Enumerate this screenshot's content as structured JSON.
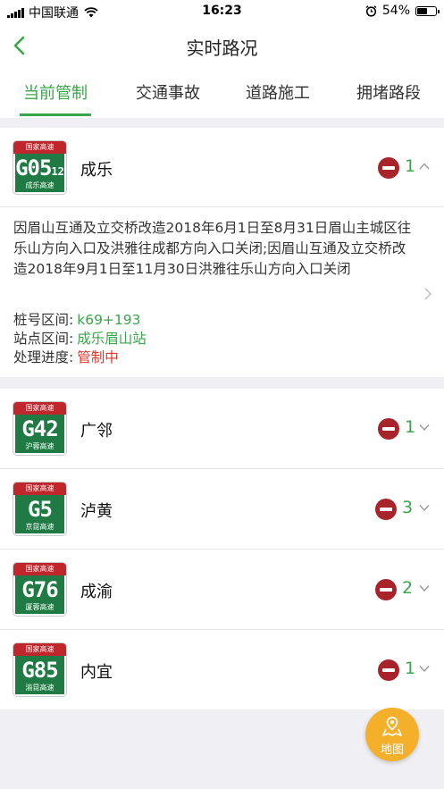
{
  "status": {
    "carrier": "中国联通",
    "time": "16:23",
    "battery": "54%"
  },
  "header": {
    "title": "实时路况"
  },
  "tabs": [
    {
      "label": "当前管制",
      "active": true
    },
    {
      "label": "交通事故",
      "active": false
    },
    {
      "label": "道路施工",
      "active": false
    },
    {
      "label": "拥堵路段",
      "active": false
    }
  ],
  "expanded": {
    "shield_top": "国家高速",
    "code": "G05",
    "code_suffix": "12",
    "shield_sub": "成乐高速",
    "name": "成乐",
    "count": "1",
    "description": "因眉山互通及立交桥改造2018年6月1日至8月31日眉山主城区往乐山方向入口及洪雅往成都方向入口关闭;因眉山互通及立交桥改造2018年9月1日至11月30日洪雅往乐山方向入口关闭",
    "fields": [
      {
        "label": "桩号区间:",
        "value": "k69+193"
      },
      {
        "label": "站点区间:",
        "value": "成乐眉山站"
      },
      {
        "label": "处理进度:",
        "value": "管制中"
      }
    ]
  },
  "roads": [
    {
      "shield_top": "国家高速",
      "code": "G42",
      "shield_sub": "沪蓉高速",
      "name": "广邻",
      "count": "1"
    },
    {
      "shield_top": "国家高速",
      "code": "G5",
      "shield_sub": "京昆高速",
      "name": "泸黄",
      "count": "3"
    },
    {
      "shield_top": "国家高速",
      "code": "G76",
      "shield_sub": "厦蓉高速",
      "name": "成渝",
      "count": "2"
    },
    {
      "shield_top": "国家高速",
      "code": "G85",
      "shield_sub": "渝昆高速",
      "name": "内宜",
      "count": "1"
    }
  ],
  "fab": {
    "label": "地图"
  },
  "colors": {
    "accent": "#3aa54a",
    "alert": "#a8232a",
    "shield_green": "#1f7a43",
    "shield_red": "#c0272d",
    "fab": "#f5b02b"
  }
}
